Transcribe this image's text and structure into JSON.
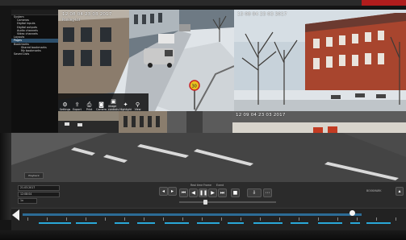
{
  "cameras": {
    "tile1": {
      "timestamp": "12 08 04 23 03 2017",
      "label": "Parking Lot"
    },
    "tile2": {
      "timestamp": "13 08 04 23 03 2017"
    },
    "tile3": {
      "timestamp": "12 09 04 23 03 2017"
    }
  },
  "tree": {
    "items": [
      {
        "label": "System",
        "level": 0
      },
      {
        "label": "Cameras",
        "level": 1
      },
      {
        "label": "Digital inputs",
        "level": 1
      },
      {
        "label": "Digital outputs",
        "level": 1
      },
      {
        "label": "Audio channels",
        "level": 1
      },
      {
        "label": "Video channels",
        "level": 1
      },
      {
        "label": "Layouts",
        "level": 0
      },
      {
        "label": "Pages",
        "level": 0
      },
      {
        "label": "Bookmarks",
        "level": 0
      },
      {
        "label": "Shared bookmarks",
        "level": 2
      },
      {
        "label": "My bookmarks",
        "level": 2
      },
      {
        "label": "Saved Lists",
        "level": 0
      }
    ]
  },
  "overlay_toolbar": {
    "buttons": [
      {
        "label": "Settings",
        "icon": "gear-icon",
        "glyph": "⚙"
      },
      {
        "label": "Export",
        "icon": "export-icon",
        "glyph": "⇪"
      },
      {
        "label": "Print",
        "icon": "print-icon",
        "glyph": "⎙"
      },
      {
        "label": "Camera",
        "icon": "camera-icon",
        "glyph": "◙"
      },
      {
        "label": "Image controls",
        "icon": "image-icon",
        "glyph": "▣"
      },
      {
        "label": "Highlight",
        "icon": "highlight-icon",
        "glyph": "✦"
      },
      {
        "label": "View",
        "icon": "zoom-icon",
        "glyph": "⚲"
      }
    ]
  },
  "playback": {
    "date_field": "21.03.2017",
    "time_field": "12:08:04",
    "speed_field": "1x",
    "mode_labels": [
      "Real time",
      "Frame",
      "Event"
    ],
    "right_label": "BOOKMARK",
    "small_button": "Playback"
  },
  "timeline": {
    "position": 0.87
  }
}
